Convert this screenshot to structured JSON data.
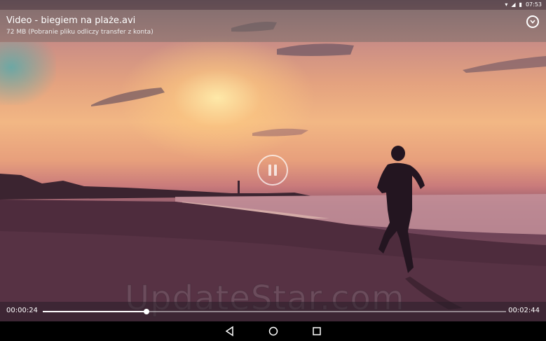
{
  "status_bar": {
    "time": "07:53",
    "icons": [
      "wifi-icon",
      "signal-icon",
      "battery-icon"
    ]
  },
  "video": {
    "title": "Video - biegiem na plaże.avi",
    "subtitle": "72 MB (Pobranie pliku odliczy transfer z konta)"
  },
  "player": {
    "current_time": "00:00:24",
    "total_time": "00:02:44",
    "progress": 0.224,
    "state": "playing"
  },
  "watermark": "UpdateStar.com",
  "nav": {
    "buttons": [
      "back-icon",
      "home-icon",
      "recents-icon"
    ]
  },
  "colors": {
    "accent": "#ffffff",
    "controls_bg": "#2a1e28"
  }
}
